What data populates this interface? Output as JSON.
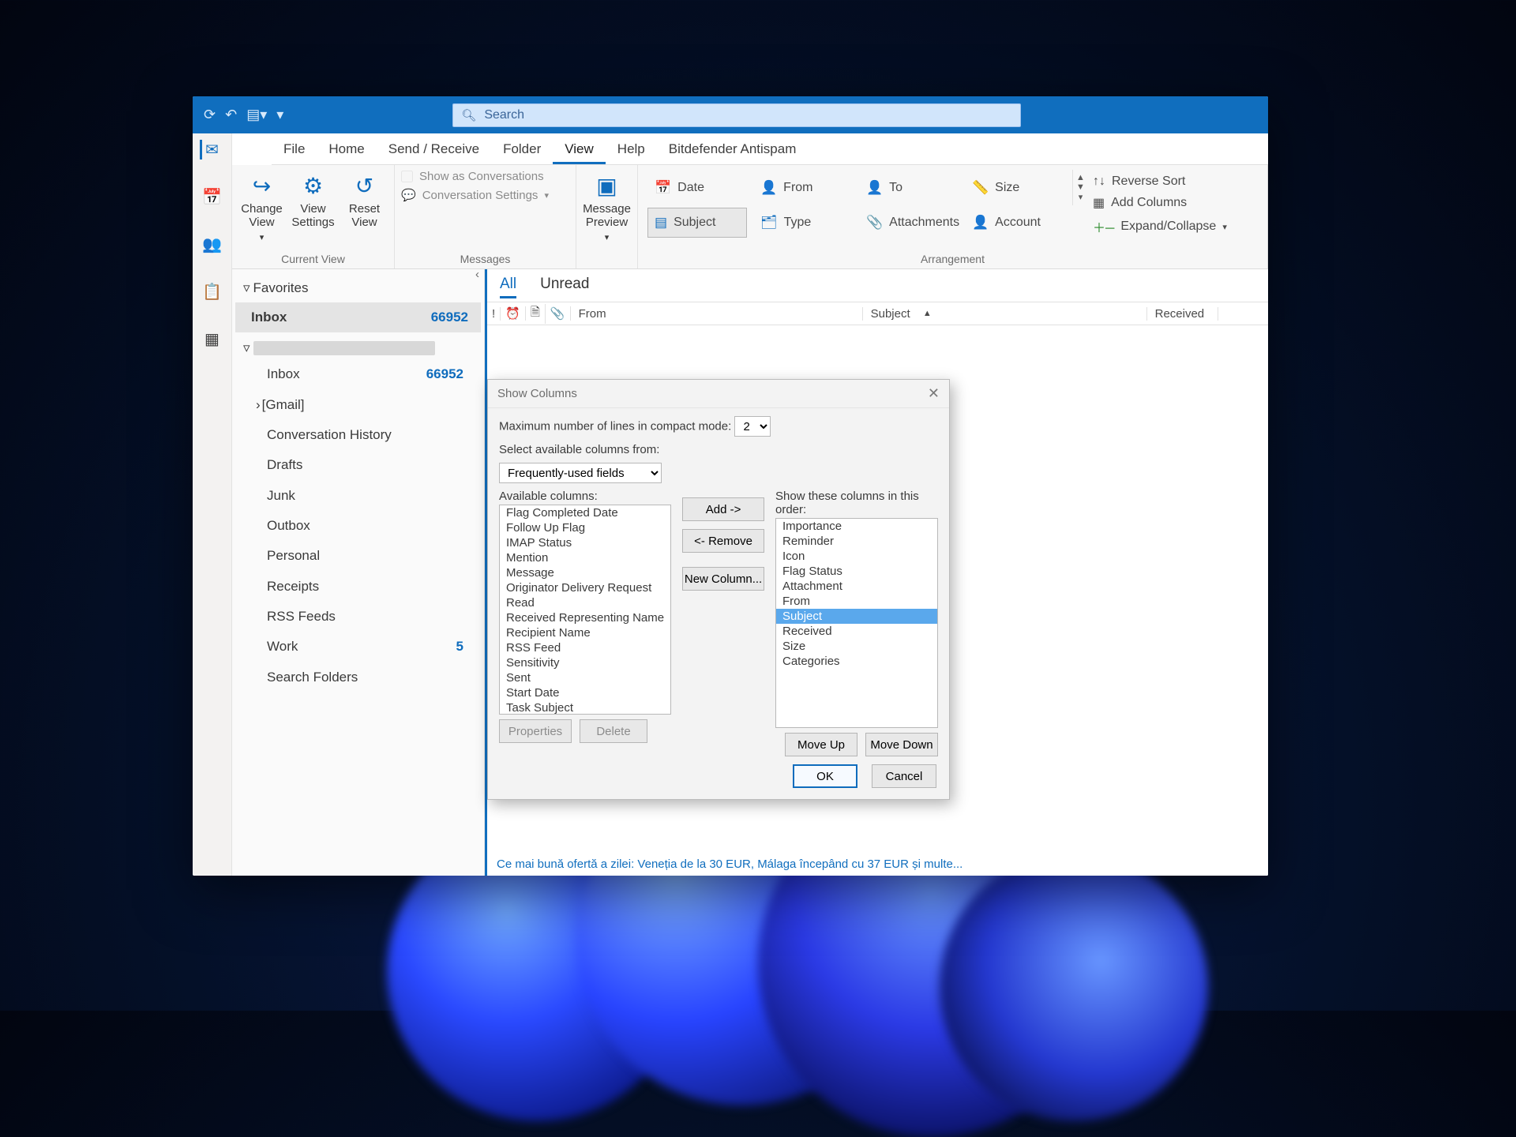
{
  "titlebar": {
    "search_placeholder": "Search"
  },
  "tabs": {
    "file": "File",
    "home": "Home",
    "sendrecv": "Send / Receive",
    "folder": "Folder",
    "view": "View",
    "help": "Help",
    "antispam": "Bitdefender Antispam"
  },
  "ribbon": {
    "change_view": "Change View",
    "view_settings": "View Settings",
    "reset_view": "Reset View",
    "group_current_view": "Current View",
    "show_conv": "Show as Conversations",
    "conv_settings": "Conversation Settings",
    "group_messages": "Messages",
    "message_preview": "Message Preview",
    "date": "Date",
    "from": "From",
    "to": "To",
    "size": "Size",
    "subject": "Subject",
    "type": "Type",
    "attachments": "Attachments",
    "account": "Account",
    "group_arrangement": "Arrangement",
    "reverse_sort": "Reverse Sort",
    "add_columns": "Add Columns",
    "expand_collapse": "Expand/Collapse"
  },
  "leftrail": {
    "mail": "✉",
    "cal": "📅",
    "people": "👥",
    "todo": "📋",
    "more": "▦"
  },
  "folders": {
    "favorites": "Favorites",
    "inbox": "Inbox",
    "inbox_count": "66952",
    "gmail": "[Gmail]",
    "conv_history": "Conversation History",
    "drafts": "Drafts",
    "junk": "Junk",
    "outbox": "Outbox",
    "personal": "Personal",
    "receipts": "Receipts",
    "rss": "RSS Feeds",
    "work": "Work",
    "work_count": "5",
    "search_folders": "Search Folders"
  },
  "maillist": {
    "all": "All",
    "unread": "Unread",
    "col_from": "From",
    "col_subject": "Subject",
    "col_received": "Received",
    "bottom_subject": "Ce mai bună ofertă a zilei: Veneția de la 30 EUR, Málaga începând cu 37 EUR și multe..."
  },
  "dialog": {
    "title": "Show Columns",
    "max_lines_label": "Maximum number of lines in compact mode:",
    "max_lines_value": "2",
    "select_from": "Select available columns from:",
    "select_from_value": "Frequently-used fields",
    "available_label": "Available columns:",
    "show_label": "Show these columns in this order:",
    "available": [
      "Flag Completed Date",
      "Follow Up Flag",
      "IMAP Status",
      "Mention",
      "Message",
      "Originator Delivery Request",
      "Read",
      "Received Representing Name",
      "Recipient Name",
      "RSS Feed",
      "Sensitivity",
      "Sent",
      "Start Date",
      "Task Subject"
    ],
    "shown": [
      "Importance",
      "Reminder",
      "Icon",
      "Flag Status",
      "Attachment",
      "From",
      "Subject",
      "Received",
      "Size",
      "Categories"
    ],
    "selected_shown_index": 6,
    "add": "Add ->",
    "remove": "<- Remove",
    "new_col": "New Column...",
    "properties": "Properties",
    "delete": "Delete",
    "moveup": "Move Up",
    "movedown": "Move Down",
    "ok": "OK",
    "cancel": "Cancel"
  }
}
